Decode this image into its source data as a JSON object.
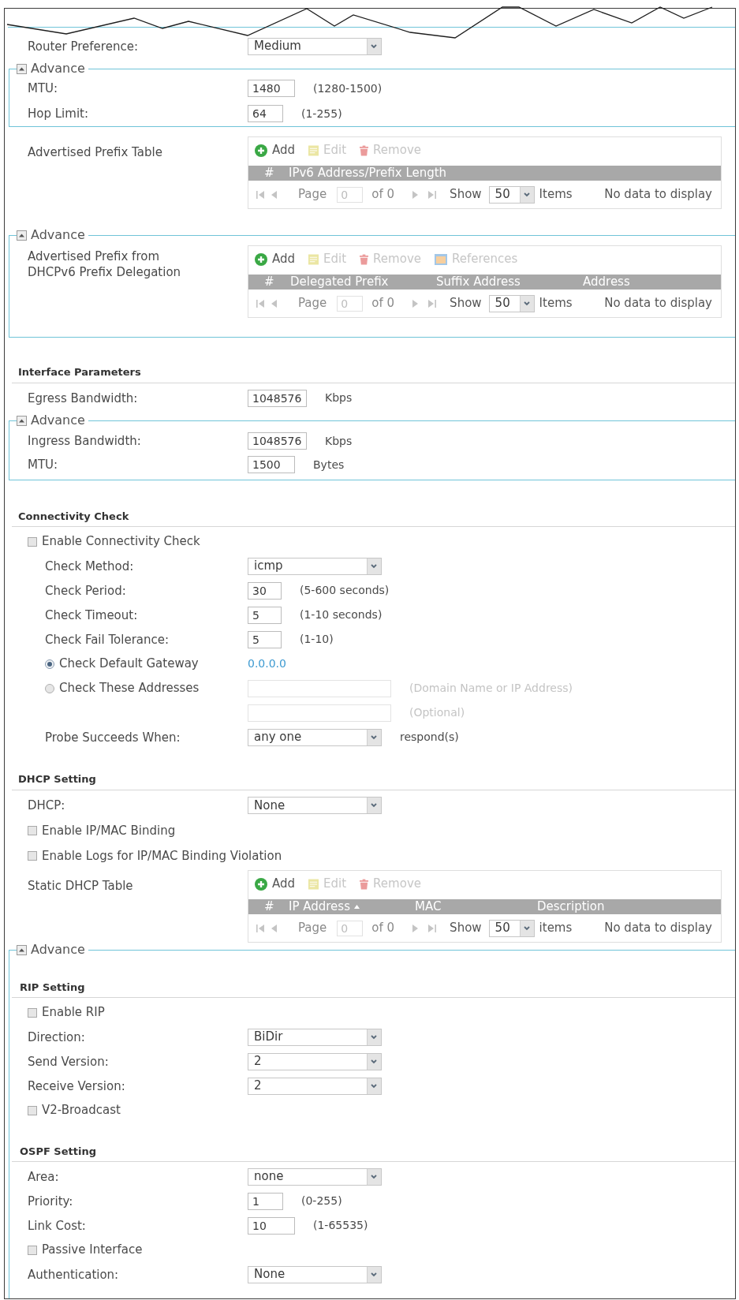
{
  "router_preference": {
    "label": "Router Preference:",
    "value": "Medium"
  },
  "advance_ra": {
    "label": "Advance",
    "expanded": true,
    "fields": [
      {
        "label": "MTU:",
        "value": "1480",
        "hint": "(1280-1500)"
      },
      {
        "label": "Hop Limit:",
        "value": "64",
        "hint": "(1-255)"
      }
    ]
  },
  "advertised_prefix_table": {
    "label": "Advertised Prefix Table",
    "toolbar": [
      {
        "kind": "add",
        "label": "Add",
        "disabled": false
      },
      {
        "kind": "edit",
        "label": "Edit",
        "disabled": true
      },
      {
        "kind": "remove",
        "label": "Remove",
        "disabled": true
      }
    ],
    "columns": [
      {
        "label": "#",
        "sorted": false
      },
      {
        "label": "IPv6 Address/Prefix Length",
        "sorted": false
      }
    ],
    "pager": {
      "disabled": true,
      "page_label": "Page",
      "page": "0",
      "page_count": "of 0",
      "show_label": "Show",
      "page_size": "50",
      "items_label": "Items",
      "status": "No data to display"
    }
  },
  "advance_delegation": {
    "label": "Advance",
    "expanded": true,
    "table": {
      "label": "Advertised Prefix from DHCPv6 Prefix Delegation",
      "toolbar": [
        {
          "kind": "add",
          "label": "Add",
          "disabled": false
        },
        {
          "kind": "edit",
          "label": "Edit",
          "disabled": true
        },
        {
          "kind": "remove",
          "label": "Remove",
          "disabled": true
        },
        {
          "kind": "references",
          "label": "References",
          "disabled": true
        }
      ],
      "columns": [
        {
          "label": "#",
          "sorted": false
        },
        {
          "label": "Delegated Prefix",
          "sorted": false
        },
        {
          "label": "Suffix Address",
          "sorted": false
        },
        {
          "label": "Address",
          "sorted": false
        }
      ],
      "pager": {
        "disabled": true,
        "page_label": "Page",
        "page": "0",
        "page_count": "of 0",
        "show_label": "Show",
        "page_size": "50",
        "items_label": "Items",
        "status": "No data to display"
      }
    }
  },
  "interface_parameters": {
    "title": "Interface Parameters",
    "egress": {
      "label": "Egress Bandwidth:",
      "value": "1048576",
      "hint": "Kbps"
    },
    "advance": {
      "label": "Advance",
      "expanded": true,
      "fields": [
        {
          "label": "Ingress Bandwidth:",
          "value": "1048576",
          "hint": "Kbps"
        },
        {
          "label": "MTU:",
          "value": "1500",
          "hint": "Bytes"
        }
      ]
    }
  },
  "connectivity_check": {
    "title": "Connectivity Check",
    "enable": {
      "label": "Enable Connectivity Check",
      "checked": false
    },
    "method": {
      "label": "Check Method:",
      "value": "icmp"
    },
    "fields": [
      {
        "label": "Check Period:",
        "value": "30",
        "hint": "(5-600 seconds)"
      },
      {
        "label": "Check Timeout:",
        "value": "5",
        "hint": "(1-10 seconds)"
      },
      {
        "label": "Check Fail Tolerance:",
        "value": "5",
        "hint": "(1-10)"
      }
    ],
    "targets": [
      {
        "kind": "gateway",
        "label": "Check Default Gateway",
        "selected": true,
        "address": "0.0.0.0"
      },
      {
        "kind": "addresses",
        "label": "Check These Addresses",
        "selected": false,
        "inputs": [
          {
            "hint": "(Domain Name or IP Address)",
            "disabled": true
          },
          {
            "hint": "(Optional)",
            "disabled": true
          }
        ]
      }
    ],
    "probe": {
      "label": "Probe Succeeds When:",
      "value": "any one",
      "hint": "respond(s)"
    }
  },
  "dhcp_setting": {
    "title": "DHCP Setting",
    "dhcp": {
      "label": "DHCP:",
      "value": "None"
    },
    "options": [
      {
        "label": "Enable IP/MAC Binding",
        "checked": false
      },
      {
        "label": "Enable Logs for IP/MAC Binding Violation",
        "checked": false
      }
    ],
    "table": {
      "label": "Static DHCP Table",
      "toolbar": [
        {
          "kind": "add",
          "label": "Add",
          "disabled": false
        },
        {
          "kind": "edit",
          "label": "Edit",
          "disabled": true
        },
        {
          "kind": "remove",
          "label": "Remove",
          "disabled": true
        }
      ],
      "columns": [
        {
          "label": "#",
          "sorted": false
        },
        {
          "label": "IP Address",
          "sorted": true
        },
        {
          "label": "MAC",
          "sorted": false
        },
        {
          "label": "Description",
          "sorted": false
        }
      ],
      "pager": {
        "disabled": true,
        "page_label": "Page",
        "page": "0",
        "page_count": "of 0",
        "show_label": "Show",
        "page_size": "50",
        "items_label": "items",
        "status": "No data to display"
      }
    }
  },
  "advance_routing": {
    "label": "Advance",
    "expanded": true,
    "rip": {
      "title": "RIP Setting",
      "enable": {
        "label": "Enable RIP",
        "checked": false
      },
      "selects": [
        {
          "label": "Direction:",
          "value": "BiDir"
        },
        {
          "label": "Send Version:",
          "value": "2"
        },
        {
          "label": "Receive Version:",
          "value": "2"
        }
      ],
      "broadcast": {
        "label": "V2-Broadcast",
        "checked": false
      }
    },
    "ospf": {
      "title": "OSPF Setting",
      "rows": [
        {
          "kind": "select",
          "label": "Area:",
          "value": "none"
        },
        {
          "kind": "input",
          "label": "Priority:",
          "value": "1",
          "hint": "(0-255)"
        },
        {
          "kind": "input",
          "label": "Link Cost:",
          "value": "10",
          "hint": "(1-65535)"
        },
        {
          "kind": "checkbox",
          "label": "Passive Interface",
          "checked": false
        },
        {
          "kind": "select",
          "label": "Authentication:",
          "value": "None"
        }
      ]
    }
  }
}
